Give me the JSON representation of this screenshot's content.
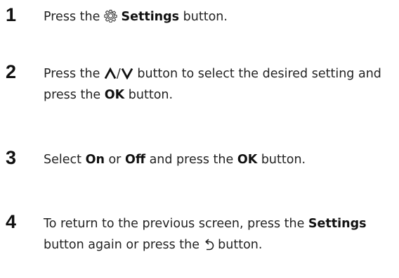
{
  "steps": [
    {
      "number": "1",
      "parts": [
        {
          "t": "Press the "
        },
        {
          "icon": "gear-icon"
        },
        {
          "t": " "
        },
        {
          "t": "Settings",
          "b": true
        },
        {
          "t": " button."
        }
      ]
    },
    {
      "number": "2",
      "parts": [
        {
          "t": "Press the "
        },
        {
          "icon": "up-arrow-icon"
        },
        {
          "t": "/"
        },
        {
          "icon": "down-arrow-icon"
        },
        {
          "t": " button to select the desired setting and press the "
        },
        {
          "t": "OK",
          "b": true
        },
        {
          "t": " button."
        }
      ]
    },
    {
      "number": "3",
      "parts": [
        {
          "t": "Select "
        },
        {
          "t": "On",
          "b": true
        },
        {
          "t": " or "
        },
        {
          "t": "Off",
          "b": true
        },
        {
          "t": " and press the "
        },
        {
          "t": "OK",
          "b": true
        },
        {
          "t": " button."
        }
      ]
    },
    {
      "number": "4",
      "parts": [
        {
          "t": "To return to the previous screen, press the "
        },
        {
          "t": "Settings",
          "b": true
        },
        {
          "t": " button again or press the "
        },
        {
          "icon": "back-arrow-icon"
        },
        {
          "t": " button."
        }
      ]
    }
  ]
}
